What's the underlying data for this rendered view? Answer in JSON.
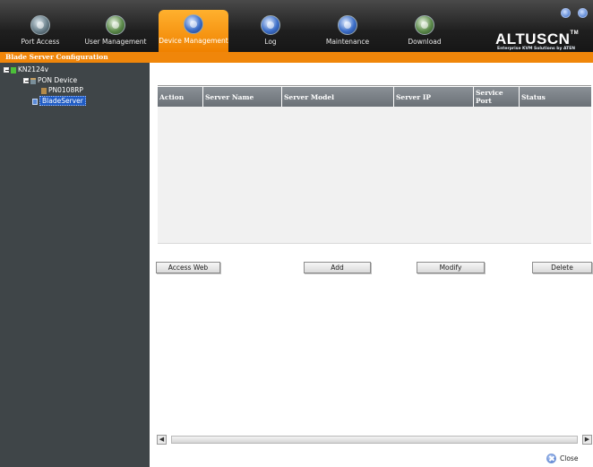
{
  "nav": {
    "tabs": [
      {
        "label": "Port Access",
        "active": false
      },
      {
        "label": "User Management",
        "active": false
      },
      {
        "label": "Device Management",
        "active": true
      },
      {
        "label": "Log",
        "active": false
      },
      {
        "label": "Maintenance",
        "active": false
      },
      {
        "label": "Download",
        "active": false
      }
    ],
    "brand": "ALTUSCN",
    "brand_tm": "TM",
    "tagline": "Enterprise KVM Solutions by ATEN"
  },
  "section_title": "Blade Server Configuration",
  "tree": {
    "root": "KN2124v",
    "device_group": "PON Device",
    "device": "PN0108RP",
    "selected": "BladeServer"
  },
  "table": {
    "columns": [
      "Action",
      "Server Name",
      "Server Model",
      "Server IP",
      "Service Port",
      "Status"
    ],
    "rows": []
  },
  "buttons": {
    "access_web": "Access Web",
    "add": "Add",
    "modify": "Modify",
    "delete": "Delete"
  },
  "footer": {
    "close": "Close"
  },
  "colors": {
    "accent": "#f0860a",
    "topbar": "#1f1f1f",
    "tree_bg": "#3f4548",
    "header_bg": "#7a8086"
  }
}
